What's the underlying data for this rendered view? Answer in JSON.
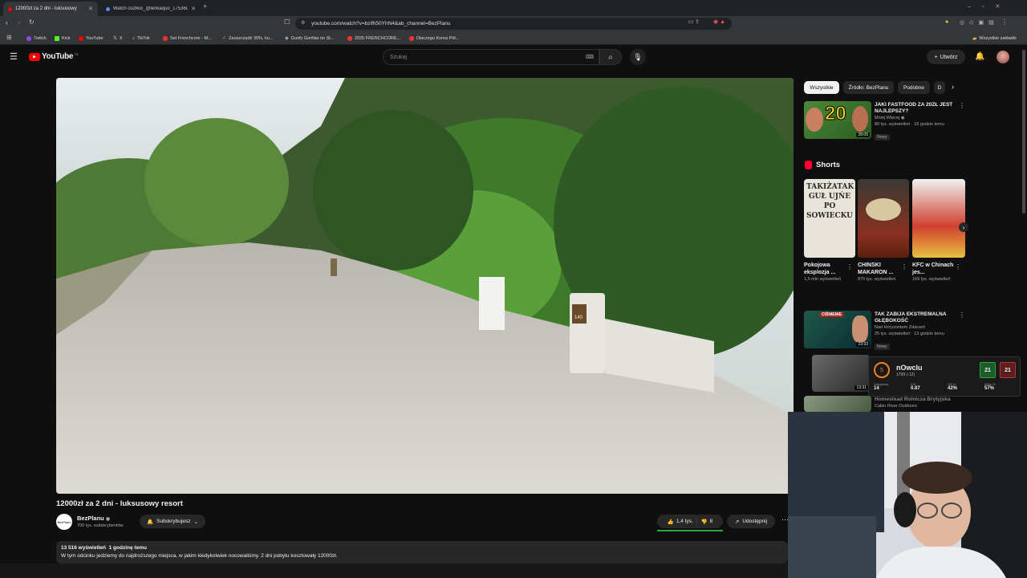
{
  "browser": {
    "tabs": [
      {
        "title": "12000zł za 2 dni - luksusowy",
        "active": true
      },
      {
        "title": "Watch ouzlkio_@lenkaquo_17536035",
        "active": false
      }
    ],
    "url": "youtube.com/watch?v=bzifh50YhN4&ab_channel=BezPlanu",
    "bookmarks": [
      "Twitch",
      "Kick",
      "YouTube",
      "X",
      "TikTok",
      "Set Frenchcore - M...",
      "Zaoszczędź 30%, ku...",
      "Goofy Gorillas on St...",
      "2025 FRENCHCORE...",
      "Dlaczego Korea Pół..."
    ],
    "all_bookmarks": "Wszystkie zakładki"
  },
  "youtube": {
    "logo": "YouTube",
    "region": "PL",
    "search_placeholder": "Szukaj",
    "create_label": "Utwórz"
  },
  "video": {
    "title": "12000zł za 2 dni - luksusowy resort",
    "channel": "BezPlanu",
    "channel_avatar_text": "BezPlanu",
    "subscribers": "700 tys. subskrybentów",
    "subscribed_label": "Subskrybujesz",
    "likes": "1,4 tys.",
    "dislikes": "8",
    "share_label": "Udostępnij",
    "views": "13 516 wyświetleń",
    "uploaded": "1 godzinę temu",
    "description": "W tym odcinku jedziemy do najdroższego miejsca, w jakim kiedykolwiek nocowaliśmy. 2 dni pobytu kosztowały 12000zł.",
    "sign_number": "140",
    "watermark": "BezPlanu"
  },
  "sidebar": {
    "chips": [
      "Wszystkie",
      "Źródło: BezPlanu",
      "Podobne",
      "D"
    ],
    "videos": [
      {
        "title": "JAKI FASTFOOD ZA 20ZŁ JEST NAJLEPSZY?",
        "channel": "Mniej Więcej",
        "meta": "80 tys. wyświetleń · 16 godzin temu",
        "badge": "Nowy",
        "duration": "28:05",
        "thumb_text": "20"
      },
      {
        "title": "TAK ZABIJA EKSTREMALNA GŁĘBOKOŚĆ",
        "channel": "Nad Horyzontem Zdarzeń",
        "meta": "25 tys. wyświetleń · 13 godzin temu",
        "badge": "Nowy",
        "duration": "23:33",
        "thumb_text": "CIŚNIENIE"
      },
      {
        "title": "",
        "channel": "",
        "meta": "",
        "badge": "",
        "duration": "13:31",
        "thumb_text": ""
      },
      {
        "title": "Homestead Rolnicza Brytyjska",
        "channel": "Cabin River Outdoors",
        "meta": "",
        "badge": "",
        "duration": "",
        "thumb_text": ""
      }
    ],
    "shorts_header": "Shorts",
    "shorts": [
      {
        "title": "Pokojowa eksplozja ...",
        "views": "1,5 mln wyświetleń",
        "thumb_text": "TAKIŻATAK GUŁ UJŃE PO SOWIECKU"
      },
      {
        "title": "CHINSKI MAKARON ...",
        "views": "870 tys. wyświetleń",
        "thumb_text": ""
      },
      {
        "title": "KFC w Chinach jes...",
        "views": "169 tys. wyświetleń",
        "thumb_text": ""
      }
    ]
  },
  "stats_overlay": {
    "name": "nOwclu",
    "rating": "1799 (-12)",
    "cols": [
      {
        "label": "Zabójstwa",
        "value": "14"
      },
      {
        "label": "K/D",
        "value": "0.87"
      },
      {
        "label": "HS %",
        "value": "42%"
      },
      {
        "label": "Wins %",
        "value": "57%"
      }
    ],
    "badge_left": "21",
    "badge_right": "21",
    "level": "5"
  },
  "colors": {
    "accent_red": "#ff0000",
    "like_bar": "#2ba640",
    "bg": "#0f0f0f"
  }
}
